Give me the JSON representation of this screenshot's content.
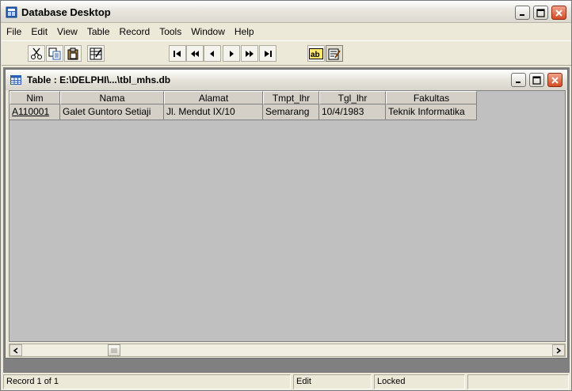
{
  "app": {
    "title": "Database Desktop"
  },
  "menu": [
    "File",
    "Edit",
    "View",
    "Table",
    "Record",
    "Tools",
    "Window",
    "Help"
  ],
  "toolbar": {
    "buttons": [
      "cut-icon",
      "copy-icon",
      "paste-icon",
      "view-data-icon",
      "first-record-icon",
      "prior-set-icon",
      "prior-record-icon",
      "next-record-icon",
      "next-set-icon",
      "last-record-icon",
      "field-view-icon",
      "edit-data-icon"
    ]
  },
  "child": {
    "title": "Table : E:\\DELPHI\\...\\tbl_mhs.db"
  },
  "grid": {
    "columns": [
      "Nim",
      "Nama",
      "Alamat",
      "Tmpt_lhr",
      "Tgl_lhr",
      "Fakultas"
    ],
    "rows": [
      [
        "A110001",
        "Galet Guntoro Setiaji",
        "Jl. Mendut IX/10",
        "Semarang",
        "10/4/1983",
        "Teknik Informatika"
      ]
    ]
  },
  "status": {
    "record": "Record 1 of 1",
    "mode": "Edit",
    "lock": "Locked"
  },
  "colors": {
    "grid_bg": "#c0c0c0",
    "mdi_bg": "#808080",
    "close_button": "#d54a25"
  }
}
